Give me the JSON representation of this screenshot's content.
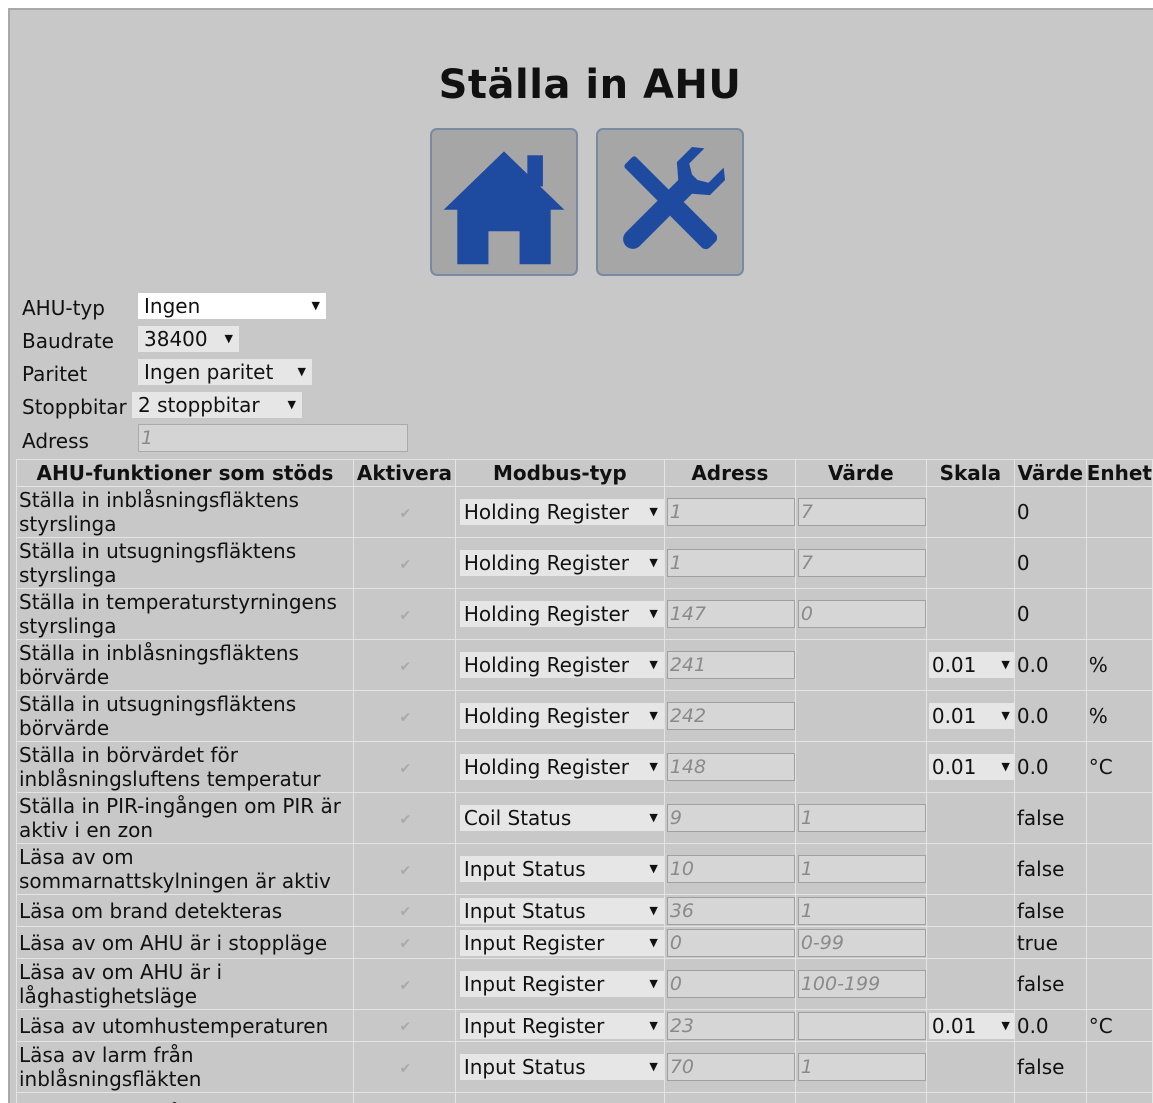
{
  "page": {
    "title": "Ställa in AHU"
  },
  "nav": {
    "home_icon": "home-icon",
    "tools_icon": "tools-icon"
  },
  "settings": {
    "ahu_type": {
      "label": "AHU-typ",
      "value": "Ingen"
    },
    "baudrate": {
      "label": "Baudrate",
      "value": "38400"
    },
    "parity": {
      "label": "Paritet",
      "value": "Ingen paritet"
    },
    "stopbits": {
      "label": "Stoppbitar",
      "value": "2 stoppbitar"
    },
    "address": {
      "label": "Adress",
      "placeholder": "1"
    }
  },
  "table": {
    "headers": [
      "AHU-funktioner som stöds",
      "Aktivera",
      "Modbus-typ",
      "Adress",
      "Värde",
      "Skala",
      "Värde",
      "Enhet"
    ],
    "rows": [
      {
        "function": "Ställa in inblåsningsfläktens styrslinga",
        "enabled": true,
        "modbus_type": "Holding Register",
        "address": "1",
        "value_in": "7",
        "scale": "",
        "value": "0",
        "unit": ""
      },
      {
        "function": "Ställa in utsugningsfläktens styrslinga",
        "enabled": true,
        "modbus_type": "Holding Register",
        "address": "1",
        "value_in": "7",
        "scale": "",
        "value": "0",
        "unit": ""
      },
      {
        "function": "Ställa in temperaturstyrningens styrslinga",
        "enabled": true,
        "modbus_type": "Holding Register",
        "address": "147",
        "value_in": "0",
        "scale": "",
        "value": "0",
        "unit": ""
      },
      {
        "function": "Ställa in inblåsningsfläktens börvärde",
        "enabled": true,
        "modbus_type": "Holding Register",
        "address": "241",
        "value_in": null,
        "scale": "0.01",
        "value": "0.0",
        "unit": "%"
      },
      {
        "function": "Ställa in utsugningsfläktens börvärde",
        "enabled": true,
        "modbus_type": "Holding Register",
        "address": "242",
        "value_in": null,
        "scale": "0.01",
        "value": "0.0",
        "unit": "%"
      },
      {
        "function": "Ställa in börvärdet för inblåsningsluftens temperatur",
        "enabled": true,
        "modbus_type": "Holding Register",
        "address": "148",
        "value_in": null,
        "scale": "0.01",
        "value": "0.0",
        "unit": "°C"
      },
      {
        "function": "Ställa in PIR-ingången om PIR är aktiv i en zon",
        "enabled": true,
        "modbus_type": "Coil Status",
        "address": "9",
        "value_in": "1",
        "scale": "",
        "value": "false",
        "unit": ""
      },
      {
        "function": "Läsa av om sommarnattskylningen är aktiv",
        "enabled": true,
        "modbus_type": "Input Status",
        "address": "10",
        "value_in": "1",
        "scale": "",
        "value": "false",
        "unit": ""
      },
      {
        "function": "Läsa om brand detekteras",
        "enabled": true,
        "modbus_type": "Input Status",
        "address": "36",
        "value_in": "1",
        "scale": "",
        "value": "false",
        "unit": ""
      },
      {
        "function": "Läsa av om AHU är i stoppläge",
        "enabled": true,
        "modbus_type": "Input Register",
        "address": "0",
        "value_in": "0-99",
        "scale": "",
        "value": "true",
        "unit": ""
      },
      {
        "function": "Läsa av om AHU är i låghastighetsläge",
        "enabled": true,
        "modbus_type": "Input Register",
        "address": "0",
        "value_in": "100-199",
        "scale": "",
        "value": "false",
        "unit": ""
      },
      {
        "function": "Läsa av utomhustemperaturen",
        "enabled": true,
        "modbus_type": "Input Register",
        "address": "23",
        "value_in": "",
        "scale": "0.01",
        "value": "0.0",
        "unit": "°C"
      },
      {
        "function": "Läsa av larm från inblåsningsfläkten",
        "enabled": true,
        "modbus_type": "Input Status",
        "address": "70",
        "value_in": "1",
        "scale": "",
        "value": "false",
        "unit": ""
      },
      {
        "function": "Läsa av larm från",
        "enabled": true,
        "modbus_type": "",
        "address": "",
        "value_in": "",
        "scale": "",
        "value": "",
        "unit": ""
      }
    ]
  },
  "colors": {
    "background": "#c8c8c8",
    "icon_blue": "#1e4aa0"
  }
}
